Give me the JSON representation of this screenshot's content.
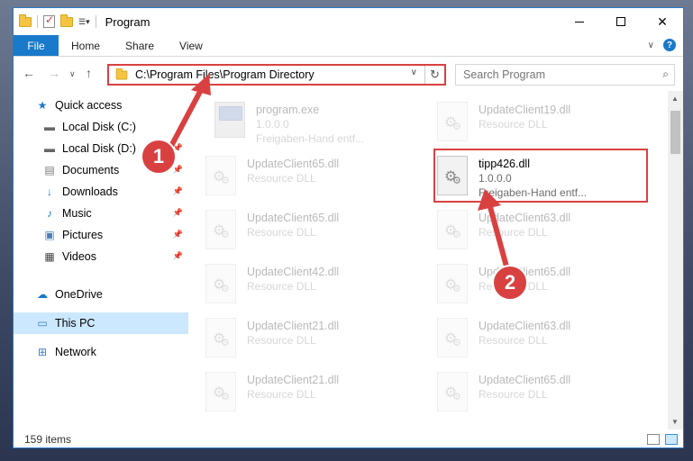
{
  "window": {
    "title": "Program",
    "controls": {
      "minimize": "minimize",
      "maximize": "maximize",
      "close": "✕"
    }
  },
  "ribbon": {
    "tabs": [
      "File",
      "Home",
      "Share",
      "View"
    ]
  },
  "address": {
    "path": "C:\\Program Files\\Program Directory"
  },
  "search": {
    "placeholder": "Search Program"
  },
  "sidebar": {
    "items": [
      {
        "label": "Quick access",
        "icon": "star-icon"
      },
      {
        "label": "Local Disk (C:)",
        "icon": "drive-icon"
      },
      {
        "label": "Local Disk (D:)",
        "icon": "drive-icon"
      },
      {
        "label": "Documents",
        "icon": "documents-icon"
      },
      {
        "label": "Downloads",
        "icon": "download-icon"
      },
      {
        "label": "Music",
        "icon": "music-icon"
      },
      {
        "label": "Pictures",
        "icon": "pictures-icon"
      },
      {
        "label": "Videos",
        "icon": "videos-icon"
      },
      {
        "label": "OneDrive",
        "icon": "cloud-icon"
      },
      {
        "label": "This PC",
        "icon": "computer-icon"
      },
      {
        "label": "Network",
        "icon": "network-icon"
      }
    ]
  },
  "files": [
    {
      "name": "program.exe",
      "line2": "1.0.0.0",
      "line3": "Freigaben-Hand entf...",
      "type": "exe"
    },
    {
      "name": "UpdateClient19.dll",
      "line2": "Resource DLL",
      "line3": "",
      "type": "dll"
    },
    {
      "name": "UpdateClient65.dll",
      "line2": "Resource DLL",
      "line3": "",
      "type": "dll"
    },
    {
      "name": "tipp426.dll",
      "line2": "1.0.0.0",
      "line3": "Freigaben-Hand entf...",
      "type": "dll"
    },
    {
      "name": "UpdateClient65.dll",
      "line2": "Resource DLL",
      "line3": "",
      "type": "dll"
    },
    {
      "name": "UpdateClient63.dll",
      "line2": "Resource DLL",
      "line3": "",
      "type": "dll"
    },
    {
      "name": "UpdateClient42.dll",
      "line2": "Resource DLL",
      "line3": "",
      "type": "dll"
    },
    {
      "name": "UpdateClient65.dll",
      "line2": "Resource DLL",
      "line3": "",
      "type": "dll"
    },
    {
      "name": "UpdateClient21.dll",
      "line2": "Resource DLL",
      "line3": "",
      "type": "dll"
    },
    {
      "name": "UpdateClient63.dll",
      "line2": "Resource DLL",
      "line3": "",
      "type": "dll"
    },
    {
      "name": "UpdateClient21.dll",
      "line2": "Resource DLL",
      "line3": "",
      "type": "dll"
    },
    {
      "name": "UpdateClient65.dll",
      "line2": "Resource DLL",
      "line3": "",
      "type": "dll"
    }
  ],
  "status": {
    "item_count": "159 items"
  },
  "annotations": {
    "callout1": "1",
    "callout2": "2",
    "color": "#d94141"
  },
  "colors": {
    "accent": "#1979ca",
    "selection": "#cce8ff"
  }
}
